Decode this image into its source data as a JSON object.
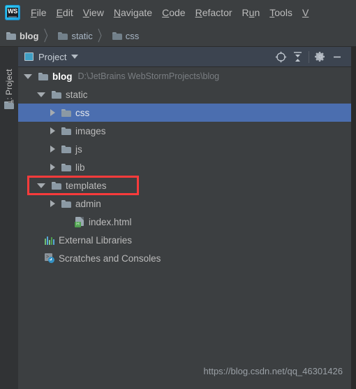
{
  "app": {
    "logo_text": "WS",
    "logo_name": "webstorm-logo"
  },
  "menubar": {
    "items": [
      {
        "mnemonic": "F",
        "rest": "ile",
        "name": "menu-file"
      },
      {
        "mnemonic": "E",
        "rest": "dit",
        "name": "menu-edit"
      },
      {
        "mnemonic": "V",
        "rest": "iew",
        "name": "menu-view"
      },
      {
        "mnemonic": "N",
        "rest": "avigate",
        "name": "menu-navigate"
      },
      {
        "mnemonic": "C",
        "rest": "ode",
        "name": "menu-code"
      },
      {
        "mnemonic": "R",
        "rest": "efactor",
        "name": "menu-refactor"
      },
      {
        "pre": "R",
        "mnemonic": "u",
        "rest": "n",
        "name": "menu-run"
      },
      {
        "mnemonic": "T",
        "rest": "ools",
        "name": "menu-tools"
      },
      {
        "mnemonic": "V",
        "rest": "",
        "name": "menu-vcs"
      }
    ]
  },
  "breadcrumb": {
    "items": [
      {
        "label": "blog",
        "bold": true
      },
      {
        "label": "static",
        "bold": false
      },
      {
        "label": "css",
        "bold": false
      }
    ],
    "separator": "〉"
  },
  "toolstrip": {
    "tab_mnemonic": "1",
    "tab_label": "1: Project",
    "tab_prefix": "1: Pro",
    "tab_suffix": "ject",
    "folder_icon": "folder-icon"
  },
  "panel": {
    "title": "Project",
    "icons": {
      "locate": "locate-icon",
      "collapse_all": "collapse-all-icon",
      "settings": "gear-icon",
      "hide": "minimize-icon"
    }
  },
  "tree": {
    "rows": [
      {
        "id": "blog",
        "indent": 8,
        "arrow": "open",
        "icon": "folder",
        "label": "blog",
        "bold": true,
        "sub": "D:\\JetBrains WebStormProjects\\blog",
        "selected": false
      },
      {
        "id": "static",
        "indent": 27,
        "arrow": "open",
        "icon": "folder",
        "label": "static",
        "bold": false,
        "sub": "",
        "selected": false
      },
      {
        "id": "css",
        "indent": 46,
        "arrow": "closed",
        "icon": "folder",
        "label": "css",
        "bold": false,
        "sub": "",
        "selected": true
      },
      {
        "id": "images",
        "indent": 46,
        "arrow": "closed",
        "icon": "folder",
        "label": "images",
        "bold": false,
        "sub": "",
        "selected": false
      },
      {
        "id": "js",
        "indent": 46,
        "arrow": "closed",
        "icon": "folder",
        "label": "js",
        "bold": false,
        "sub": "",
        "selected": false
      },
      {
        "id": "lib",
        "indent": 46,
        "arrow": "closed",
        "icon": "folder",
        "label": "lib",
        "bold": false,
        "sub": "",
        "selected": false
      },
      {
        "id": "templates",
        "indent": 27,
        "arrow": "open",
        "icon": "folder",
        "label": "templates",
        "bold": false,
        "sub": "",
        "selected": false,
        "highlighted": true
      },
      {
        "id": "admin",
        "indent": 46,
        "arrow": "closed",
        "icon": "folder",
        "label": "admin",
        "bold": false,
        "sub": "",
        "selected": false
      },
      {
        "id": "index-html",
        "indent": 65,
        "arrow": "none",
        "icon": "html",
        "label": "index.html",
        "bold": false,
        "sub": "",
        "selected": false
      },
      {
        "id": "external-libraries",
        "indent": 22,
        "arrow": "none",
        "icon": "lib",
        "label": "External Libraries",
        "bold": false,
        "sub": "",
        "selected": false
      },
      {
        "id": "scratches-and-consoles",
        "indent": 22,
        "arrow": "none",
        "icon": "scratch",
        "label": "Scratches and Consoles",
        "bold": false,
        "sub": "",
        "selected": false
      }
    ],
    "html_badge_letter": "H"
  },
  "highlight": {
    "color": "#fb3b3b",
    "target_row": "templates"
  },
  "watermark": {
    "text": "https://blog.csdn.net/qq_46301426"
  },
  "colors": {
    "background": "#3c3f41",
    "panel_header": "#3c4450",
    "selection": "#4b6eaf",
    "strip": "#313335",
    "text": "#bbbbbb",
    "text_dim": "#7a7e82",
    "accent_red": "#fb3b3b"
  }
}
